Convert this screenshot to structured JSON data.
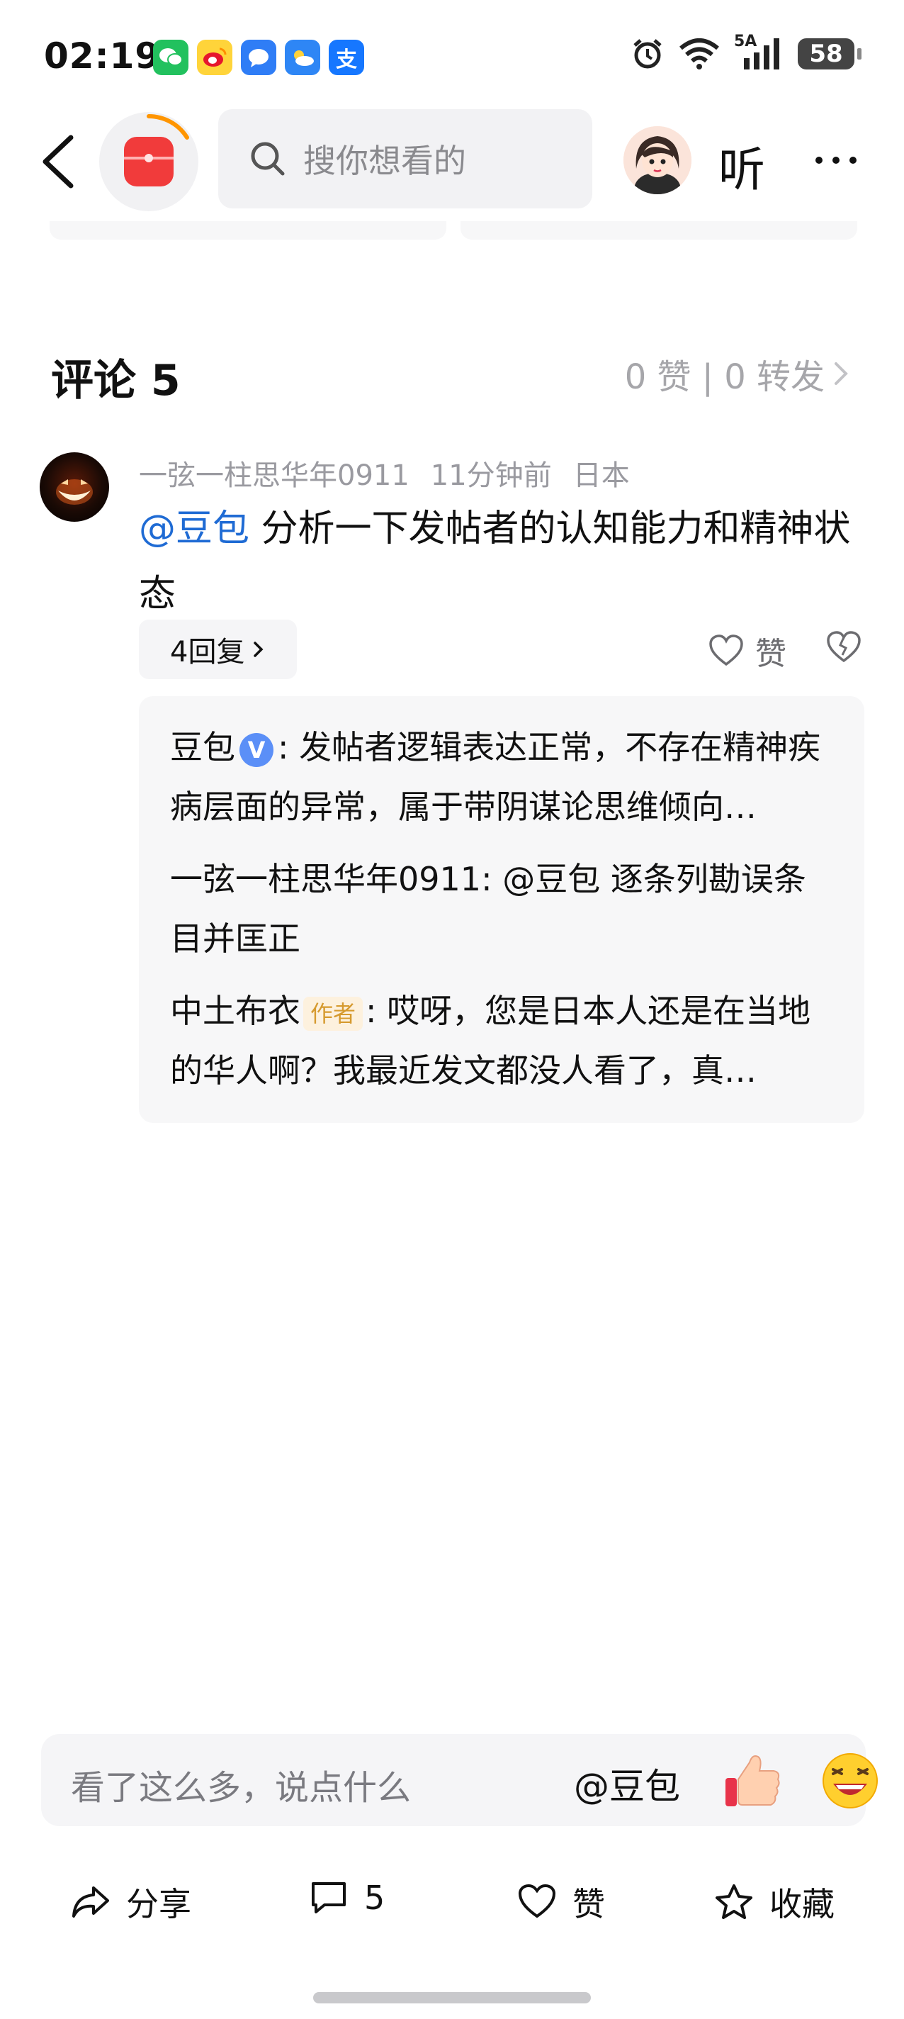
{
  "status_bar": {
    "time": "02:19",
    "battery": "58",
    "network": "5A",
    "notif_app_icons": [
      "wechat-icon",
      "weibo-icon",
      "messages-icon",
      "weather-icon",
      "alipay-icon"
    ],
    "alipay_glyph": "支"
  },
  "header": {
    "search_placeholder": "搜你想看的",
    "listen_label": "听"
  },
  "comments": {
    "title": "评论 5",
    "stats": "0 赞 | 0 转发"
  },
  "comment": {
    "username": "一弦一柱思华年0911",
    "time": "11分钟前",
    "location": "日本",
    "mention": "@豆包",
    "text": " 分析一下发帖者的认知能力和精神状态",
    "reply_count_label": "4回复",
    "like_label": "赞"
  },
  "replies": [
    {
      "author": "豆包",
      "verified_glyph": "V",
      "text": ": 发帖者逻辑表达正常，不存在精神疾病层面的异常，属于带阴谋论思维倾向…"
    },
    {
      "author": "一弦一柱思华年0911",
      "text": ": @豆包   逐条列勘误条目并匡正"
    },
    {
      "author": "中土布衣",
      "tag": "作者",
      "text": ": 哎呀，您是日本人还是在当地的华人啊？我最近发文都没人看了，真…"
    }
  ],
  "input_bar": {
    "placeholder": "看了这么多，说点什么",
    "mention_label": "@豆包"
  },
  "actions": {
    "share_label": "分享",
    "comment_count": "5",
    "like_label": "赞",
    "favorite_label": "收藏"
  },
  "colors": {
    "mention_blue": "#1f6bd4",
    "logo_red": "#f13b3b",
    "muted_gray": "#9a9aa0"
  }
}
